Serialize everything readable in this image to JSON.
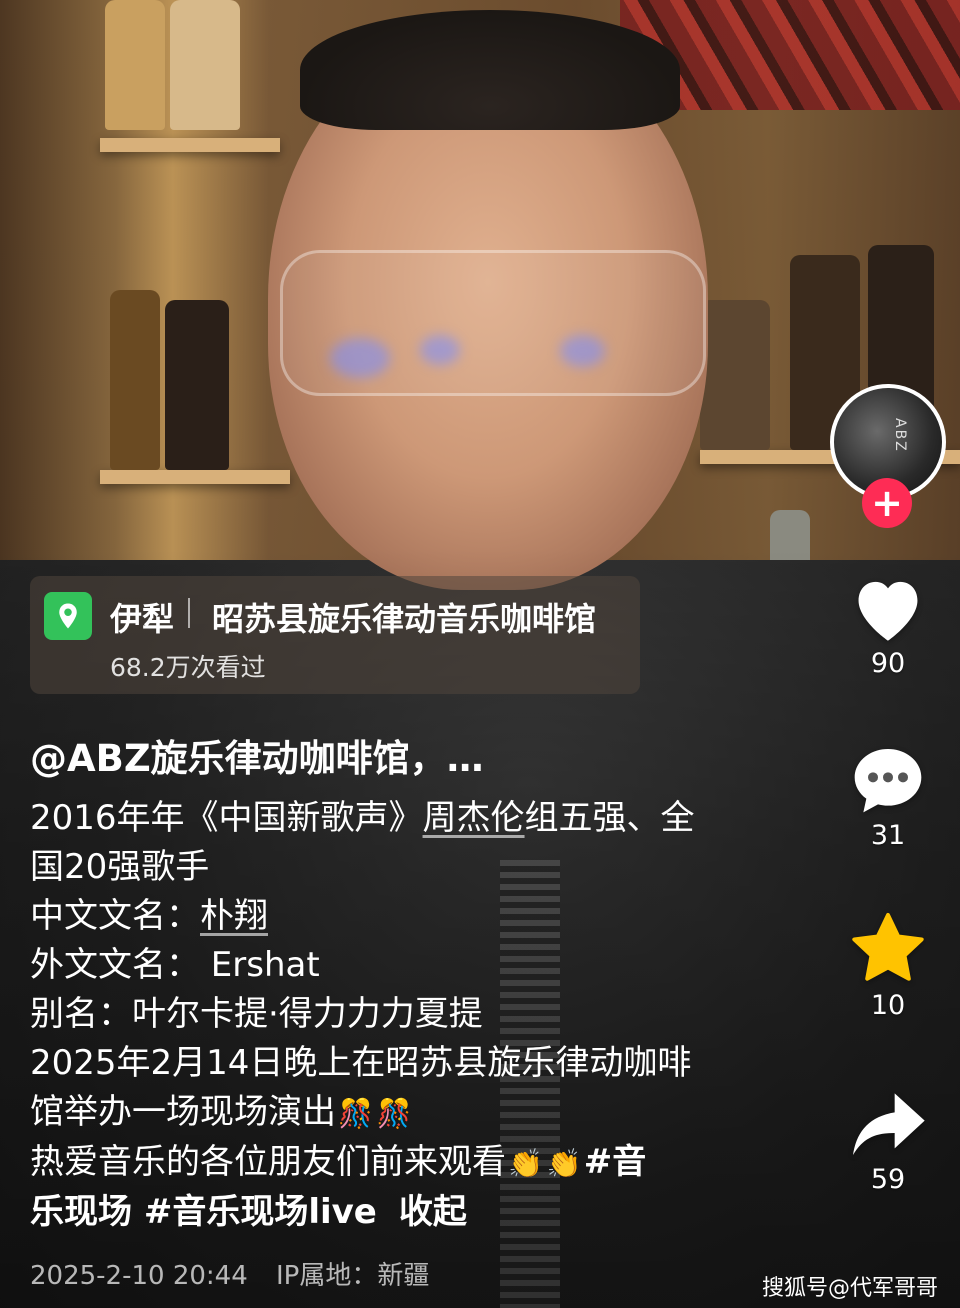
{
  "location": {
    "icon": "location-pin-icon",
    "city": "伊犁",
    "place": "昭苏县旋乐律动音乐咖啡馆",
    "views": "68.2万次看过"
  },
  "caption": {
    "author": "@ABZ旋乐律动咖啡馆，…",
    "lines": {
      "l1a": "2016年年《中国新歌声》",
      "l1b": "周杰伦",
      "l1c": "组五强、全",
      "l2": "国20强歌手",
      "l3a": "中文文名：",
      "l3b": "朴翔",
      "l4": "外文文名： Ershat",
      "l5": "别名：叶尔卡提·得力力力夏提",
      "l6": "2025年2月14日晚上在昭苏县旋乐律动咖啡",
      "l7": "馆举办一场现场演出",
      "l8": "热爱音乐的各位朋友们前来观看",
      "l8tag": "#音",
      "l9": "乐现场 #音乐现场live",
      "fold": "收起"
    },
    "emoji": {
      "party": "🎊",
      "clap": "👏"
    }
  },
  "meta": {
    "datetime": "2025-2-10 20:44",
    "ip": "IP属地：新疆"
  },
  "watermark": "搜狐号@代军哥哥",
  "rail": {
    "avatar_text": "ABZ",
    "follow_label": "+",
    "likes": "90",
    "comments": "31",
    "favorites": "10",
    "shares": "59",
    "colors": {
      "like": "#ffffff",
      "star": "#ffc300",
      "follow": "#fe2c55"
    }
  }
}
